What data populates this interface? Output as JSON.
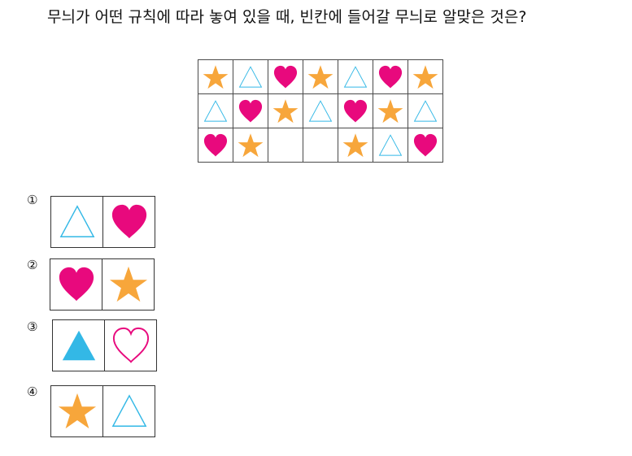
{
  "question": {
    "text": "무늬가 어떤 규칙에 따라 놓여 있을 때, 빈칸에 들어갈 무늬로 알맞은 것은?"
  },
  "colors": {
    "star": "#f7a63b",
    "heart": "#e8097d",
    "triangle": "#33b8e6",
    "grid_border": "#4a4a4a"
  },
  "pattern": {
    "rows": [
      [
        "star",
        "triangle-outline",
        "heart",
        "star",
        "triangle-outline",
        "heart",
        "star"
      ],
      [
        "triangle-outline",
        "heart",
        "star",
        "triangle-outline",
        "heart",
        "star",
        "triangle-outline"
      ],
      [
        "heart",
        "star",
        "",
        "",
        "star",
        "triangle-outline",
        "heart"
      ]
    ]
  },
  "options": [
    {
      "number": "①",
      "shapes": [
        "triangle-outline",
        "heart"
      ]
    },
    {
      "number": "②",
      "shapes": [
        "heart",
        "star"
      ]
    },
    {
      "number": "③",
      "shapes": [
        "triangle-filled",
        "heart-outline"
      ]
    },
    {
      "number": "④",
      "shapes": [
        "star",
        "triangle-outline"
      ]
    }
  ]
}
